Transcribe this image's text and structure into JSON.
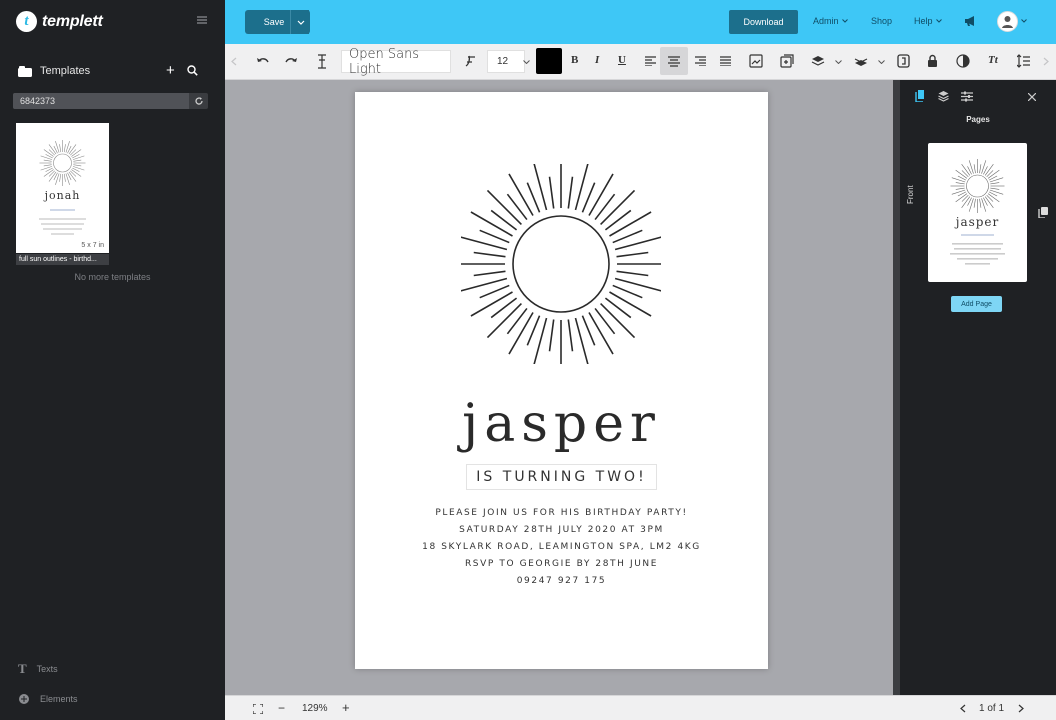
{
  "sidebar": {
    "logo_text": "templett",
    "logo_letter": "t",
    "templates_label": "Templates",
    "search_value": "6842373",
    "template_caption": "full sun outlines - birthd...",
    "template_size": "5 x 7 in",
    "thumb_name": "jonah",
    "no_more": "No more templates",
    "texts_label": "Texts",
    "elements_label": "Elements"
  },
  "topbar": {
    "save_label": "Save",
    "download_label": "Download",
    "admin_label": "Admin",
    "shop_label": "Shop",
    "help_label": "Help",
    "accent": "#3ec7f6",
    "button_color": "#1c6f8c"
  },
  "toolbar": {
    "font_family": "Open Sans Light",
    "font_size": "12",
    "text_color": "#000000",
    "bold": "B",
    "italic": "I",
    "underline": "U",
    "tt": "Tt"
  },
  "invitation": {
    "name": "jasper",
    "turning": "IS TURNING TWO!",
    "line1": "PLEASE JOIN US FOR HIS BIRTHDAY PARTY!",
    "line2": "SATURDAY 28TH JULY 2020 AT 3PM",
    "line3": "18 SKYLARK ROAD, LEAMINGTON SPA, LM2 4KG",
    "line4": "RSVP TO GEORGIE BY 28TH JUNE",
    "line5": "09247 927 175"
  },
  "bottombar": {
    "zoom": "129%",
    "minus": "−",
    "plus": "+",
    "page_indicator": "1 of 1"
  },
  "rightpanel": {
    "title": "Pages",
    "front_label": "Front",
    "thumb_name": "jasper",
    "add_page": "Add Page"
  }
}
